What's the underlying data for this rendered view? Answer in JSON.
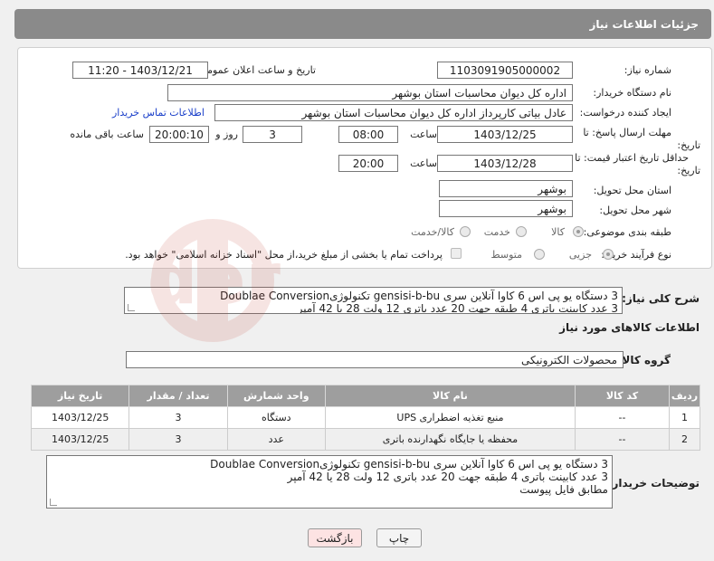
{
  "header": {
    "title": "جزئیات اطلاعات نیاز"
  },
  "fields": {
    "need_number_label": "شماره نیاز:",
    "need_number": "1103091905000002",
    "announce_label": "تاریخ و ساعت اعلان عمومی:",
    "announce_value": "1403/12/21 - 11:20",
    "buyer_org_label": "نام دستگاه خریدار:",
    "buyer_org": "اداره کل دیوان محاسبات استان بوشهر",
    "requester_label": "ایجاد کننده درخواست:",
    "requester": "عادل بیاتی کارپرداز اداره کل دیوان محاسبات استان بوشهر",
    "contact_link": "اطلاعات تماس خریدار",
    "deadline_label_1": "مهلت ارسال پاسخ: تا",
    "deadline_label_2": "تاریخ:",
    "deadline_date": "1403/12/25",
    "time_label": "ساعت",
    "deadline_time": "08:00",
    "days_value": "3",
    "days_label": "روز و",
    "remaining_time": "20:00:10",
    "remaining_label": "ساعت باقی مانده",
    "validity_label_1": "حداقل تاریخ اعتبار قیمت: تا",
    "validity_label_2": "تاریخ:",
    "validity_date": "1403/12/28",
    "validity_time_label": "ساعت",
    "validity_time": "20:00",
    "province_label": "استان محل تحویل:",
    "province": "بوشهر",
    "city_label": "شهر محل تحویل:",
    "city": "بوشهر",
    "category_label": "طبقه بندی موضوعی:",
    "category_options": [
      "کالا",
      "خدمت",
      "کالا/خدمت"
    ],
    "process_label": "نوع فرآیند خرید :",
    "process_options": [
      "جزیی",
      "متوسط"
    ],
    "treasury_note": "پرداخت تمام یا بخشی از مبلغ خرید،از محل \"اسناد خزانه اسلامی\" خواهد بود."
  },
  "description": {
    "label": "شرح کلی نیاز:",
    "line1": "3 دستگاه یو پی اس 6 کاوا آنلاین سری gensisi-b-bu تکنولوژیDoublae Conversion",
    "line2": "3 عدد کابینت باتری 4 طبقه جهت 20 عدد باتری 12 ولت 28 یا 42 آمپر"
  },
  "goods_info": {
    "title": "اطلاعات کالاهای مورد نیاز",
    "group_label": "گروه کالا:",
    "group_value": "محصولات الکترونیکی"
  },
  "table": {
    "headers": [
      "ردیف",
      "کد کالا",
      "نام کالا",
      "واحد شمارش",
      "تعداد / مقدار",
      "تاریخ نیاز"
    ],
    "rows": [
      [
        "1",
        "--",
        "منبع تغذیه اضطراری UPS",
        "دستگاه",
        "3",
        "1403/12/25"
      ],
      [
        "2",
        "--",
        "محفظه یا جایگاه نگهدارنده باتری",
        "عدد",
        "3",
        "1403/12/25"
      ]
    ]
  },
  "buyer_notes": {
    "label": "توضیحات خریدار:",
    "line1": "3 دستگاه یو پی اس 6 کاوا آنلاین سری gensisi-b-bu تکنولوژیDoublae Conversion",
    "line2": "3 عدد کابینت باتری 4 طبقه جهت 20 عدد باتری 12 ولت 28 یا 42 آمپر",
    "line3": "مطابق فایل پیوست"
  },
  "buttons": {
    "print": "چاپ",
    "back": "بازگشت"
  },
  "colors": {
    "header": "#8a8a8a",
    "link": "#1a3fc9",
    "back_button": "#fde3e3"
  }
}
